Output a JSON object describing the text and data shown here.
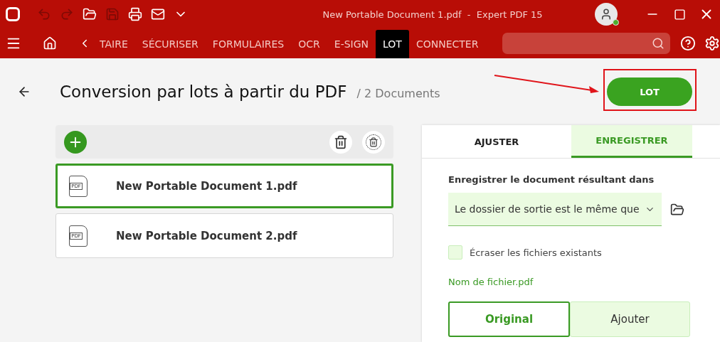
{
  "window": {
    "title": "New Portable Document 1.pdf  -  Expert PDF 15",
    "quick_tools": [
      {
        "kind": "undo",
        "disabled": true
      },
      {
        "kind": "redo",
        "disabled": true
      },
      {
        "kind": "open",
        "disabled": false
      },
      {
        "kind": "save",
        "disabled": true
      },
      {
        "kind": "print",
        "disabled": false
      },
      {
        "kind": "mail",
        "disabled": false
      },
      {
        "kind": "more",
        "disabled": false
      }
    ],
    "user": {
      "online": true
    }
  },
  "ribbon": {
    "tabs": [
      {
        "label": "TAIRE",
        "selected": false
      },
      {
        "label": "SÉCURISER",
        "selected": false
      },
      {
        "label": "FORMULAIRES",
        "selected": false
      },
      {
        "label": "OCR",
        "selected": false
      },
      {
        "label": "E-SIGN",
        "selected": false
      },
      {
        "label": "LOT",
        "selected": true
      },
      {
        "label": "CONNECTER",
        "selected": false
      }
    ]
  },
  "page": {
    "title": "Conversion par lots à partir du PDF",
    "count": "/ 2 Documents",
    "run_button": "LOT"
  },
  "files": [
    {
      "name": "New Portable Document 1.pdf",
      "icon": "PDF",
      "selected": true
    },
    {
      "name": "New Portable Document 2.pdf",
      "icon": "PDF",
      "selected": false
    }
  ],
  "settings": {
    "tabs": [
      {
        "label": "AJUSTER",
        "selected": false
      },
      {
        "label": "ENREGISTRER",
        "selected": true
      }
    ],
    "save_label": "Enregistrer le document résultant dans",
    "folder_value": "Le dossier de sortie est le même que",
    "overwrite": {
      "label": "Écraser les fichiers existants",
      "checked": false
    },
    "file_name_link": "Nom de fichier.pdf",
    "mode": [
      {
        "label": "Original",
        "selected": true
      },
      {
        "label": "Ajouter",
        "selected": false
      }
    ]
  }
}
